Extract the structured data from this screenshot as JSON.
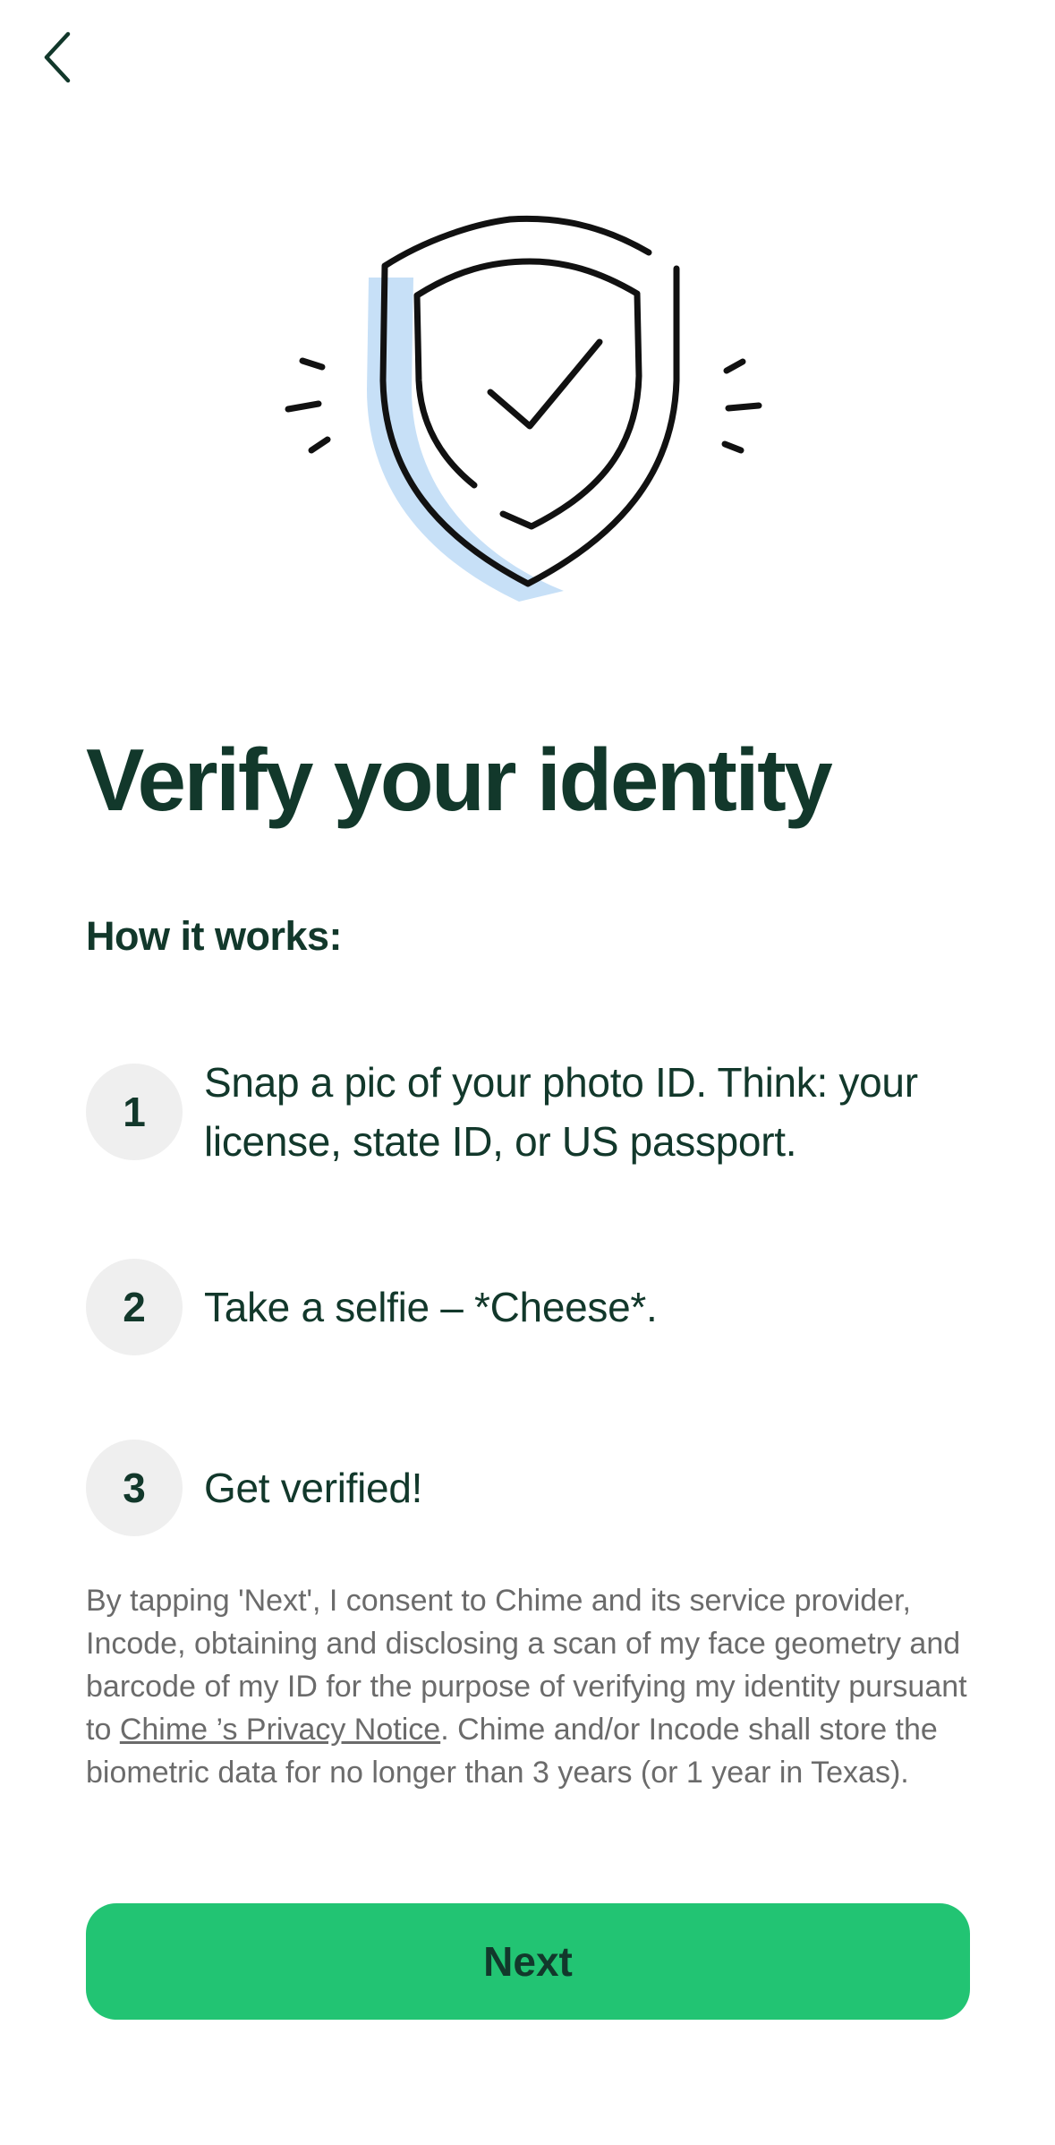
{
  "header": {
    "back_icon": "chevron-left-icon"
  },
  "hero": {
    "icon": "shield-check-icon",
    "accent_shadow": "#c7e0f7",
    "stroke": "#111111"
  },
  "title": "Verify your identity",
  "subtitle": "How it works:",
  "steps": [
    {
      "number": "1",
      "text": "Snap a pic of your photo ID. Think: your license, state ID, or US passport."
    },
    {
      "number": "2",
      "text": "Take a selfie – *Cheese*."
    },
    {
      "number": "3",
      "text": "Get verified!"
    }
  ],
  "consent": {
    "before_link": "By tapping 'Next', I consent to Chime and its service provider, Incode, obtaining and disclosing a scan of my face geometry and barcode of my ID for the purpose of verifying my identity pursuant to ",
    "link_text": "Chime ’s Privacy Notice",
    "after_link": ". Chime and/or Incode shall store the biometric data for no longer than 3 years (or 1 year in Texas)."
  },
  "next_button": {
    "label": "Next"
  },
  "colors": {
    "primary_text": "#12382b",
    "secondary_text": "#6b6b6b",
    "accent_green": "#22c473",
    "step_circle_bg": "#efefef"
  }
}
